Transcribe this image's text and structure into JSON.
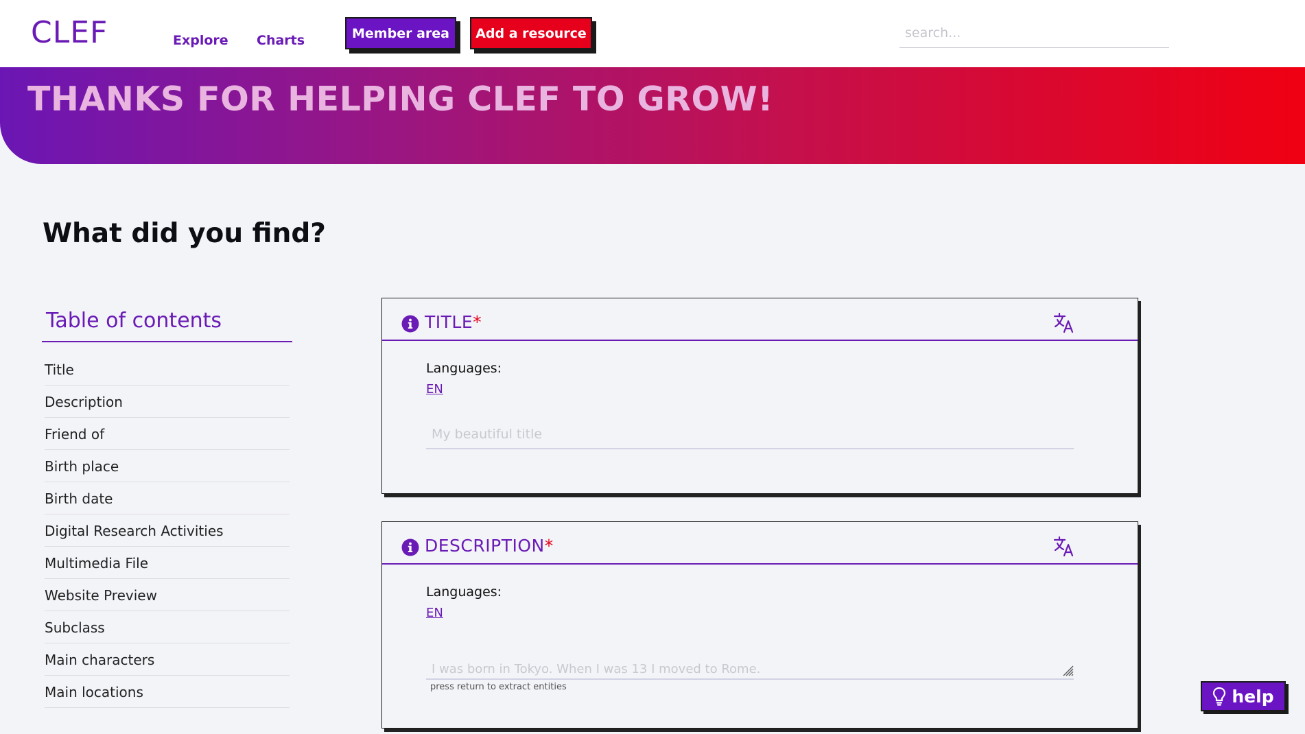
{
  "header": {
    "logo": "CLEF",
    "nav": [
      {
        "label": "Explore"
      },
      {
        "label": "Charts"
      }
    ],
    "member_button": "Member area",
    "add_button": "Add a resource",
    "search_placeholder": "search..."
  },
  "banner": {
    "title": "THANKS FOR HELPING CLEF TO GROW!"
  },
  "page_title": "What did you find?",
  "toc": {
    "heading": "Table of contents",
    "items": [
      "Title",
      "Description",
      "Friend of",
      "Birth place",
      "Birth date",
      "Digital Research Activities",
      "Multimedia File",
      "Website Preview",
      "Subclass",
      "Main characters",
      "Main locations"
    ]
  },
  "cards": {
    "title": {
      "label": "TITLE",
      "required_mark": "*",
      "languages_label": "Languages:",
      "language": "EN",
      "placeholder": "My beautiful title"
    },
    "description": {
      "label": "DESCRIPTION",
      "required_mark": "*",
      "languages_label": "Languages:",
      "language": "EN",
      "placeholder": "I was born in Tokyo. When I was 13 I moved to Rome.",
      "hint": "press return to extract entities"
    }
  },
  "help_button": "help",
  "colors": {
    "accent": "#6a1bb5",
    "brand_red": "#e6001c",
    "background": "#f3f4f8"
  }
}
